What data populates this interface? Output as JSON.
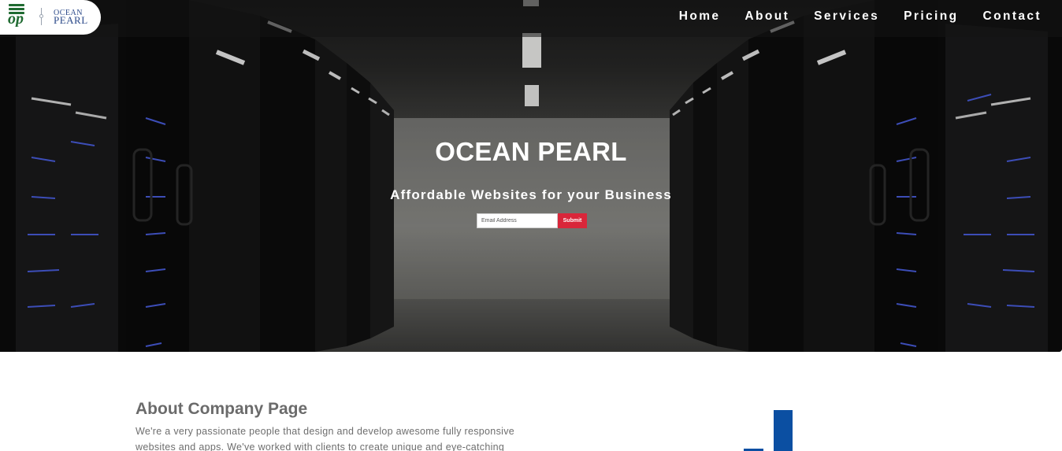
{
  "brand": {
    "logo_top": "OCEAN",
    "logo_bottom": "PEARL",
    "colors": {
      "logo_green": "#1f6a31",
      "logo_blue": "#2c4a8a"
    }
  },
  "nav": {
    "items": [
      {
        "label": "Home"
      },
      {
        "label": "About"
      },
      {
        "label": "Services"
      },
      {
        "label": "Pricing"
      },
      {
        "label": "Contact"
      }
    ]
  },
  "hero": {
    "title": "OCEAN PEARL",
    "subtitle": "Affordable Websites for your Business",
    "email_placeholder": "Email Address",
    "submit_label": "Submit",
    "colors": {
      "submit": "#d9263a"
    }
  },
  "about": {
    "heading": "About Company Page",
    "text": "We're a very passionate people that design and develop awesome fully responsive websites and apps. We've worked with clients to create unique and eye-catching",
    "colors": {
      "graphic_blue": "#0b4fa2"
    }
  }
}
